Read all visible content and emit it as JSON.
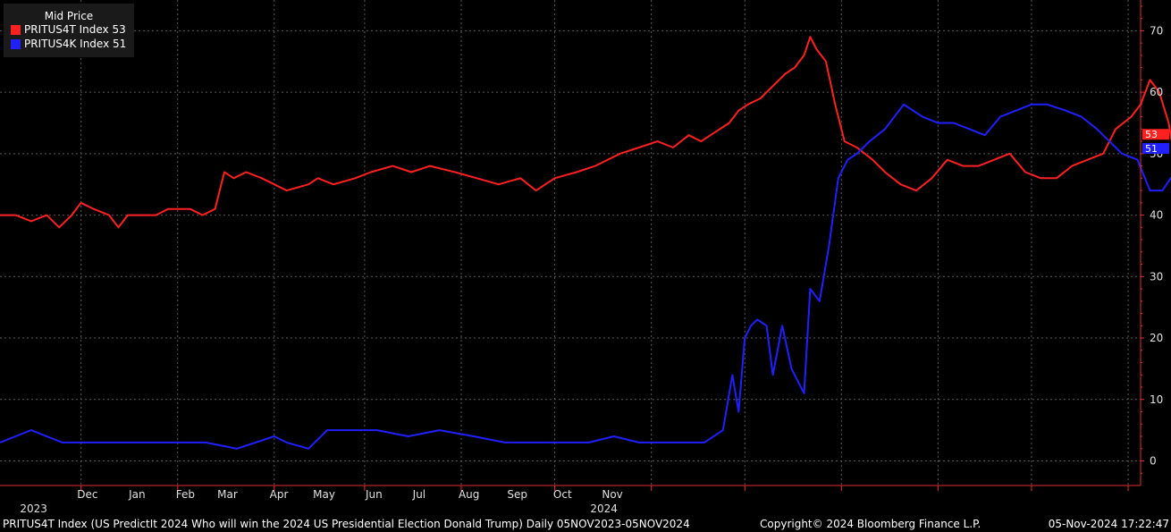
{
  "chart_data": {
    "type": "line",
    "legend": {
      "title": "Mid Price",
      "placement": "top-left"
    },
    "x_range": [
      "2023-11-05",
      "2024-11-05"
    ],
    "ylim": [
      -4,
      75
    ],
    "y_ticks": [
      0,
      10,
      20,
      30,
      40,
      50,
      60,
      70
    ],
    "y_axis_side": "right",
    "grid": true,
    "month_ticks": [
      {
        "date": "2023-12-01",
        "label": "Dec"
      },
      {
        "date": "2024-01-01",
        "label": "Jan"
      },
      {
        "date": "2024-02-01",
        "label": "Feb"
      },
      {
        "date": "2024-03-01",
        "label": "Mar"
      },
      {
        "date": "2024-04-01",
        "label": "Apr"
      },
      {
        "date": "2024-05-01",
        "label": "May"
      },
      {
        "date": "2024-06-01",
        "label": "Jun"
      },
      {
        "date": "2024-07-01",
        "label": "Jul"
      },
      {
        "date": "2024-08-01",
        "label": "Aug"
      },
      {
        "date": "2024-09-01",
        "label": "Sep"
      },
      {
        "date": "2024-10-01",
        "label": "Oct"
      },
      {
        "date": "2024-11-01",
        "label": "Nov"
      }
    ],
    "year_ticks": [
      {
        "date": "2023-12-01",
        "label": "2023"
      },
      {
        "date": "2024-06-01",
        "label": "2024"
      }
    ],
    "series": [
      {
        "name": "PRITUS4T Index",
        "last": "53",
        "color": "#ff2020",
        "points": [
          [
            "2023-11-05",
            40
          ],
          [
            "2023-11-10",
            40
          ],
          [
            "2023-11-15",
            39
          ],
          [
            "2023-11-20",
            40
          ],
          [
            "2023-11-24",
            38
          ],
          [
            "2023-11-28",
            40
          ],
          [
            "2023-12-01",
            42
          ],
          [
            "2023-12-05",
            41
          ],
          [
            "2023-12-10",
            40
          ],
          [
            "2023-12-13",
            38
          ],
          [
            "2023-12-16",
            40
          ],
          [
            "2023-12-25",
            40
          ],
          [
            "2023-12-29",
            41
          ],
          [
            "2024-01-05",
            41
          ],
          [
            "2024-01-09",
            40
          ],
          [
            "2024-01-13",
            41
          ],
          [
            "2024-01-16",
            47
          ],
          [
            "2024-01-19",
            46
          ],
          [
            "2024-01-23",
            47
          ],
          [
            "2024-01-28",
            46
          ],
          [
            "2024-02-01",
            45
          ],
          [
            "2024-02-05",
            44
          ],
          [
            "2024-02-12",
            45
          ],
          [
            "2024-02-15",
            46
          ],
          [
            "2024-02-20",
            45
          ],
          [
            "2024-02-27",
            46
          ],
          [
            "2024-03-03",
            47
          ],
          [
            "2024-03-10",
            48
          ],
          [
            "2024-03-16",
            47
          ],
          [
            "2024-03-22",
            48
          ],
          [
            "2024-03-30",
            47
          ],
          [
            "2024-04-06",
            46
          ],
          [
            "2024-04-13",
            45
          ],
          [
            "2024-04-20",
            46
          ],
          [
            "2024-04-25",
            44
          ],
          [
            "2024-05-01",
            46
          ],
          [
            "2024-05-08",
            47
          ],
          [
            "2024-05-14",
            48
          ],
          [
            "2024-05-22",
            50
          ],
          [
            "2024-05-28",
            51
          ],
          [
            "2024-06-03",
            52
          ],
          [
            "2024-06-08",
            51
          ],
          [
            "2024-06-13",
            53
          ],
          [
            "2024-06-17",
            52
          ],
          [
            "2024-06-23",
            54
          ],
          [
            "2024-06-26",
            55
          ],
          [
            "2024-06-29",
            57
          ],
          [
            "2024-07-02",
            58
          ],
          [
            "2024-07-06",
            59
          ],
          [
            "2024-07-10",
            61
          ],
          [
            "2024-07-14",
            63
          ],
          [
            "2024-07-17",
            64
          ],
          [
            "2024-07-20",
            66
          ],
          [
            "2024-07-22",
            69
          ],
          [
            "2024-07-24",
            67
          ],
          [
            "2024-07-27",
            65
          ],
          [
            "2024-07-30",
            58
          ],
          [
            "2024-08-02",
            52
          ],
          [
            "2024-08-06",
            51
          ],
          [
            "2024-08-11",
            49
          ],
          [
            "2024-08-15",
            47
          ],
          [
            "2024-08-20",
            45
          ],
          [
            "2024-08-25",
            44
          ],
          [
            "2024-08-30",
            46
          ],
          [
            "2024-09-04",
            49
          ],
          [
            "2024-09-09",
            48
          ],
          [
            "2024-09-14",
            48
          ],
          [
            "2024-09-19",
            49
          ],
          [
            "2024-09-24",
            50
          ],
          [
            "2024-09-29",
            47
          ],
          [
            "2024-10-04",
            46
          ],
          [
            "2024-10-09",
            46
          ],
          [
            "2024-10-14",
            48
          ],
          [
            "2024-10-19",
            49
          ],
          [
            "2024-10-24",
            50
          ],
          [
            "2024-10-28",
            54
          ],
          [
            "2024-11-02",
            56
          ],
          [
            "2024-11-05",
            58
          ],
          [
            "2024-11-08",
            62
          ],
          [
            "2024-11-11",
            60
          ],
          [
            "2024-11-14",
            55
          ],
          [
            "2024-11-16",
            49
          ],
          [
            "2024-11-19",
            49
          ],
          [
            "2024-11-22",
            53
          ]
        ]
      },
      {
        "name": "PRITUS4K Index",
        "last": "51",
        "color": "#2020ff",
        "points": [
          [
            "2023-11-05",
            3
          ],
          [
            "2023-11-10",
            4
          ],
          [
            "2023-11-15",
            5
          ],
          [
            "2023-11-20",
            4
          ],
          [
            "2023-11-25",
            3
          ],
          [
            "2023-12-01",
            3
          ],
          [
            "2023-12-10",
            3
          ],
          [
            "2023-12-20",
            3
          ],
          [
            "2024-01-01",
            3
          ],
          [
            "2024-01-10",
            3
          ],
          [
            "2024-01-20",
            2
          ],
          [
            "2024-02-01",
            4
          ],
          [
            "2024-02-05",
            3
          ],
          [
            "2024-02-12",
            2
          ],
          [
            "2024-02-18",
            5
          ],
          [
            "2024-02-25",
            5
          ],
          [
            "2024-03-05",
            5
          ],
          [
            "2024-03-15",
            4
          ],
          [
            "2024-03-25",
            5
          ],
          [
            "2024-04-05",
            4
          ],
          [
            "2024-04-15",
            3
          ],
          [
            "2024-04-25",
            3
          ],
          [
            "2024-05-05",
            3
          ],
          [
            "2024-05-12",
            3
          ],
          [
            "2024-05-20",
            4
          ],
          [
            "2024-05-28",
            3
          ],
          [
            "2024-06-05",
            3
          ],
          [
            "2024-06-12",
            3
          ],
          [
            "2024-06-18",
            3
          ],
          [
            "2024-06-24",
            5
          ],
          [
            "2024-06-27",
            14
          ],
          [
            "2024-06-29",
            8
          ],
          [
            "2024-07-01",
            20
          ],
          [
            "2024-07-03",
            22
          ],
          [
            "2024-07-05",
            23
          ],
          [
            "2024-07-08",
            22
          ],
          [
            "2024-07-10",
            14
          ],
          [
            "2024-07-13",
            22
          ],
          [
            "2024-07-16",
            15
          ],
          [
            "2024-07-20",
            11
          ],
          [
            "2024-07-22",
            28
          ],
          [
            "2024-07-25",
            26
          ],
          [
            "2024-07-28",
            35
          ],
          [
            "2024-07-31",
            46
          ],
          [
            "2024-08-03",
            49
          ],
          [
            "2024-08-06",
            50
          ],
          [
            "2024-08-10",
            52
          ],
          [
            "2024-08-15",
            54
          ],
          [
            "2024-08-21",
            58
          ],
          [
            "2024-08-27",
            56
          ],
          [
            "2024-09-01",
            55
          ],
          [
            "2024-09-06",
            55
          ],
          [
            "2024-09-11",
            54
          ],
          [
            "2024-09-16",
            53
          ],
          [
            "2024-09-21",
            56
          ],
          [
            "2024-09-26",
            57
          ],
          [
            "2024-10-01",
            58
          ],
          [
            "2024-10-06",
            58
          ],
          [
            "2024-10-12",
            57
          ],
          [
            "2024-10-17",
            56
          ],
          [
            "2024-10-22",
            54
          ],
          [
            "2024-10-26",
            52
          ],
          [
            "2024-10-30",
            50
          ],
          [
            "2024-11-04",
            49
          ],
          [
            "2024-11-08",
            44
          ],
          [
            "2024-11-12",
            44
          ],
          [
            "2024-11-16",
            47
          ],
          [
            "2024-11-19",
            56
          ],
          [
            "2024-11-22",
            51
          ]
        ]
      }
    ]
  },
  "footer": {
    "description": "PRITUS4T Index (US PredictIt 2024 Who will win the 2024 US Presidential Election Donald Trump)  Daily 05NOV2023-05NOV2024",
    "copyright": "Copyright© 2024 Bloomberg Finance L.P.",
    "timestamp": "05-Nov-2024 17:22:47"
  }
}
